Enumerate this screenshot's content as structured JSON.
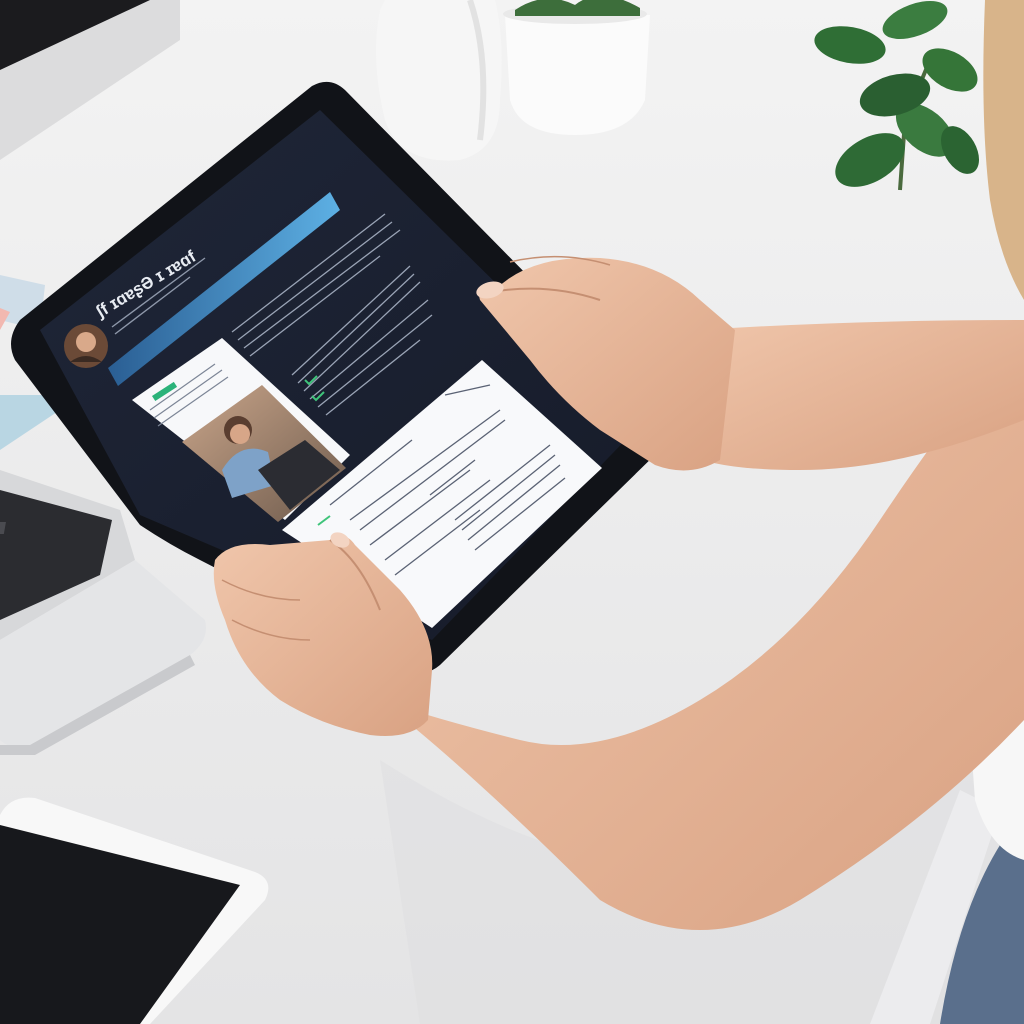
{
  "tablet": {
    "heading": "ʃf ɪɑɐʂƏ ɪ ɪɐɑf"
  },
  "colors": {
    "desk": "#efefef",
    "tablet_bezel": "#121419",
    "screen_bg": "#1c2233",
    "accent_bar": "#3d8fcc",
    "skin": "#e7b79a",
    "plant": "#2f6b34",
    "pot": "#f4f4f4"
  },
  "icons": {
    "avatar": "profile-avatar-icon",
    "check": "check-mark-icon"
  }
}
